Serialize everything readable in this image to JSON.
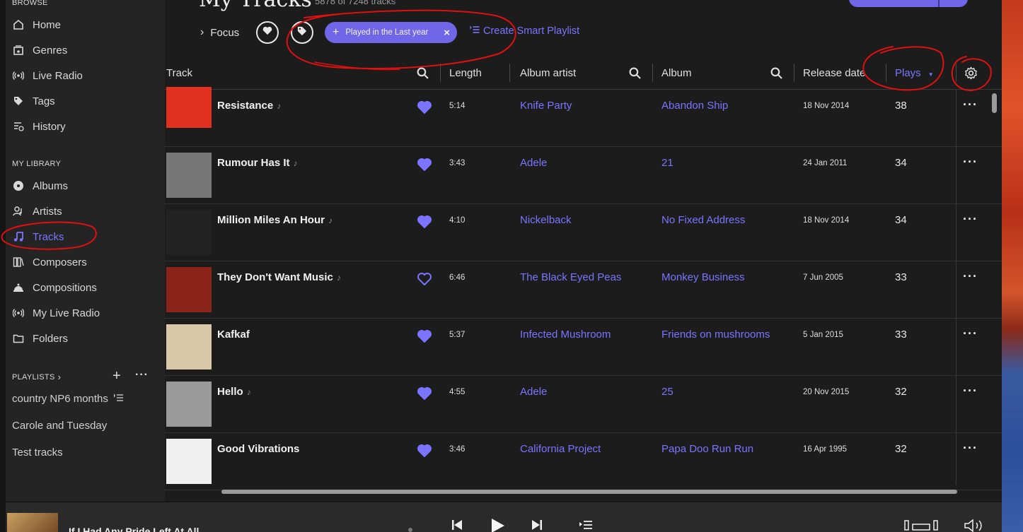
{
  "sidebar": {
    "browse_heading": "BROWSE",
    "browse_items": [
      {
        "label": "Home",
        "icon": "home-icon"
      },
      {
        "label": "Genres",
        "icon": "genres-icon"
      },
      {
        "label": "Live Radio",
        "icon": "radio-icon"
      },
      {
        "label": "Tags",
        "icon": "tag-icon"
      },
      {
        "label": "History",
        "icon": "history-icon"
      }
    ],
    "library_heading": "MY LIBRARY",
    "library_items": [
      {
        "label": "Albums",
        "icon": "album-icon"
      },
      {
        "label": "Artists",
        "icon": "artist-icon"
      },
      {
        "label": "Tracks",
        "icon": "music-note-icon",
        "active": true
      },
      {
        "label": "Composers",
        "icon": "composers-icon"
      },
      {
        "label": "Compositions",
        "icon": "compositions-icon"
      },
      {
        "label": "My Live Radio",
        "icon": "radio-icon"
      },
      {
        "label": "Folders",
        "icon": "folder-icon"
      }
    ],
    "playlists_heading": "PLAYLISTS",
    "playlists": [
      "country NP6 months",
      "Carole and Tuesday",
      "Test tracks"
    ]
  },
  "header": {
    "title": "My Tracks",
    "count": "5878 of 7248 tracks",
    "focus_label": "Focus",
    "filter_chip": "Played in the Last year",
    "smart_playlist_label": "Create Smart Playlist"
  },
  "columns": {
    "track": "Track",
    "length": "Length",
    "album_artist": "Album artist",
    "album": "Album",
    "release_date": "Release date",
    "plays": "Plays"
  },
  "tracks": [
    {
      "title": "Resistance",
      "liked": true,
      "length": "5:14",
      "artist": "Knife Party",
      "album": "Abandon Ship",
      "date": "18 Nov 2014",
      "plays": "38",
      "art": "#e0301e"
    },
    {
      "title": "Rumour Has It",
      "liked": true,
      "length": "3:43",
      "artist": "Adele",
      "album": "21",
      "date": "24 Jan 2011",
      "plays": "34",
      "art": "#777777"
    },
    {
      "title": "Million Miles An Hour",
      "liked": true,
      "length": "4:10",
      "artist": "Nickelback",
      "album": "No Fixed Address",
      "date": "18 Nov 2014",
      "plays": "34",
      "art": "#222222"
    },
    {
      "title": "They Don't Want Music",
      "liked": false,
      "length": "6:46",
      "artist": "The Black Eyed Peas",
      "album": "Monkey Business",
      "date": "7 Jun 2005",
      "plays": "33",
      "art": "#8a2418"
    },
    {
      "title": "Kafkaf",
      "liked": true,
      "length": "5:37",
      "artist": "Infected Mushroom",
      "album": "Friends on mushrooms",
      "date": "5 Jan 2015",
      "plays": "33",
      "art": "#d8c8a8"
    },
    {
      "title": "Hello",
      "liked": true,
      "length": "4:55",
      "artist": "Adele",
      "album": "25",
      "date": "20 Nov 2015",
      "plays": "32",
      "art": "#9a9a9a"
    },
    {
      "title": "Good Vibrations",
      "liked": false,
      "liked_filled": true,
      "length": "3:46",
      "artist": "California Project",
      "album": "Papa Doo Run Run",
      "date": "16 Apr 1995",
      "plays": "32",
      "art": "#f0f0f0"
    }
  ],
  "now_playing": {
    "title": "If I Had Any Pride Left At All"
  },
  "colors": {
    "accent": "#7b74ff",
    "chip": "#6f67e8",
    "annotation": "#e01010"
  }
}
